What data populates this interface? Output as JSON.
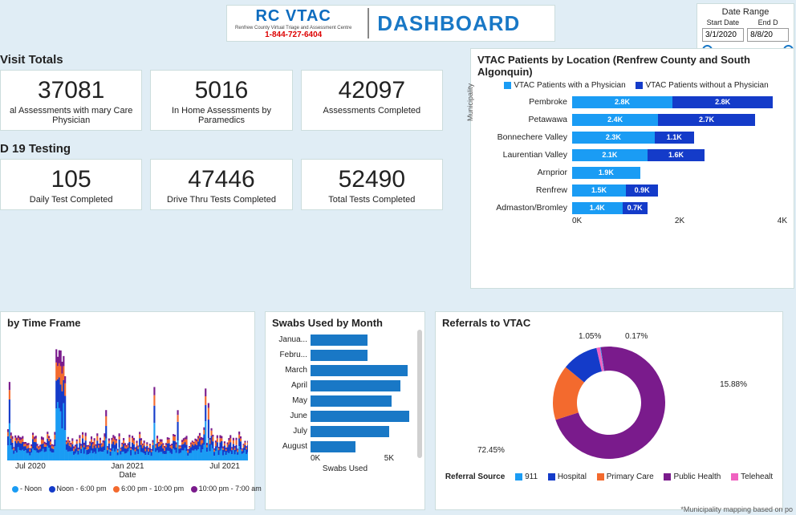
{
  "header": {
    "logo_main": "RC VTAC",
    "logo_sub": "Renfrew County Virtual Triage and Assessment Centre",
    "logo_phone": "1-844-727-6404",
    "title": "DASHBOARD"
  },
  "date_range": {
    "title": "Date Range",
    "start_label": "Start Date",
    "end_label": "End D",
    "start_value": "3/1/2020",
    "end_value": "8/8/20"
  },
  "visit_totals": {
    "title": "Visit Totals",
    "kpis": [
      {
        "value": "37081",
        "caption": "al Assessments with mary Care Physician"
      },
      {
        "value": "5016",
        "caption": "In Home Assessments by Paramedics"
      },
      {
        "value": "42097",
        "caption": "Assessments Completed"
      }
    ]
  },
  "covid_testing": {
    "title": "D 19 Testing",
    "kpis": [
      {
        "value": "105",
        "caption": "Daily Test Completed"
      },
      {
        "value": "47446",
        "caption": "Drive Thru Tests Completed"
      },
      {
        "value": "52490",
        "caption": "Total Tests Completed"
      }
    ]
  },
  "location_chart": {
    "title": "VTAC Patients by Location (Renfrew County and South Algonquin)",
    "ylabel": "Municipality",
    "legend": [
      {
        "name": "VTAC Patients with a Physician",
        "color": "#1a9cf4"
      },
      {
        "name": "VTAC Patients without a Physician",
        "color": "#143bc9"
      }
    ],
    "axis_ticks": [
      "0K",
      "2K",
      "4K"
    ],
    "max": 6000
  },
  "timeframe": {
    "title": "by Time Frame",
    "xlabel": "Date",
    "xticks": [
      "Jul 2020",
      "Jan 2021",
      "Jul 2021"
    ],
    "legend": [
      {
        "name": "- Noon",
        "color": "#1a9cf4"
      },
      {
        "name": "Noon - 6:00 pm",
        "color": "#143bc9"
      },
      {
        "name": "6:00 pm - 10:00 pm",
        "color": "#f36a2e"
      },
      {
        "name": "10:00 pm - 7:00 am",
        "color": "#7a1b8c"
      }
    ]
  },
  "swabs": {
    "title": "Swabs Used by Month",
    "xlabel": "Swabs Used",
    "xticks": [
      "0K",
      "5K"
    ]
  },
  "referrals": {
    "title": "Referrals to VTAC",
    "legend_label": "Referral Source",
    "slices_display": [
      {
        "label": "72.45%"
      },
      {
        "label": "15.88%"
      },
      {
        "label": "1.05%"
      },
      {
        "label": "0.17%"
      }
    ],
    "legend": [
      {
        "name": "911",
        "color": "#1a9cf4"
      },
      {
        "name": "Hospital",
        "color": "#143bc9"
      },
      {
        "name": "Primary Care",
        "color": "#f36a2e"
      },
      {
        "name": "Public Health",
        "color": "#7a1b8c"
      },
      {
        "name": "Telehealt",
        "color": "#f062c0"
      }
    ]
  },
  "footnote": "*Municipality mapping based on po",
  "chart_data": [
    {
      "type": "bar",
      "id": "location_chart",
      "orientation": "horizontal",
      "stacked": true,
      "title": "VTAC Patients by Location (Renfrew County and South Algonquin)",
      "ylabel": "Municipality",
      "categories": [
        "Pembroke",
        "Petawawa",
        "Bonnechere Valley",
        "Laurentian Valley",
        "Arnprior",
        "Renfrew",
        "Admaston/Bromley"
      ],
      "series": [
        {
          "name": "VTAC Patients with a Physician",
          "color": "#1a9cf4",
          "values": [
            2800,
            2400,
            2300,
            2100,
            1900,
            1500,
            1400
          ]
        },
        {
          "name": "VTAC Patients without a Physician",
          "color": "#143bc9",
          "values": [
            2800,
            2700,
            1100,
            1600,
            null,
            900,
            700
          ]
        }
      ],
      "xlim": [
        0,
        6000
      ],
      "data_labels": [
        [
          "2.8K",
          "2.4K",
          "2.3K",
          "2.1K",
          "1.9K",
          "1.5K",
          "1.4K"
        ],
        [
          "2.8K",
          "2.7K",
          "1.1K",
          "1.6K",
          "",
          "0.9K",
          "0.7K"
        ]
      ]
    },
    {
      "type": "bar",
      "id": "swabs_by_month",
      "orientation": "horizontal",
      "title": "Swabs Used by Month",
      "xlabel": "Swabs Used",
      "categories": [
        "Janua...",
        "Febru...",
        "March",
        "April",
        "May",
        "June",
        "July",
        "August"
      ],
      "values": [
        3200,
        3200,
        5400,
        5000,
        4500,
        5500,
        4400,
        2500
      ],
      "xlim": [
        0,
        6000
      ],
      "color": "#1978c6"
    },
    {
      "type": "pie",
      "id": "referrals_donut",
      "title": "Referrals to VTAC",
      "donut": true,
      "series": [
        {
          "name": "Public Health",
          "value": 72.45,
          "color": "#7a1b8c"
        },
        {
          "name": "Primary Care",
          "value": 15.88,
          "color": "#f36a2e"
        },
        {
          "name": "Hospital",
          "value": 10.45,
          "color": "#143bc9"
        },
        {
          "name": "Telehealth",
          "value": 1.05,
          "color": "#f062c0"
        },
        {
          "name": "911",
          "value": 0.17,
          "color": "#1a9cf4"
        }
      ]
    },
    {
      "type": "bar",
      "id": "time_frame_stacked",
      "orientation": "vertical",
      "stacked": true,
      "title": "by Time Frame",
      "xlabel": "Date",
      "x_range": [
        "2020-04",
        "2021-08"
      ],
      "note": "Daily stacked counts by time-of-day band; individual daily values not legible at this resolution.",
      "series": [
        {
          "name": "- Noon",
          "color": "#1a9cf4"
        },
        {
          "name": "Noon - 6:00 pm",
          "color": "#143bc9"
        },
        {
          "name": "6:00 pm - 10:00 pm",
          "color": "#f36a2e"
        },
        {
          "name": "10:00 pm - 7:00 am",
          "color": "#7a1b8c"
        }
      ]
    }
  ]
}
